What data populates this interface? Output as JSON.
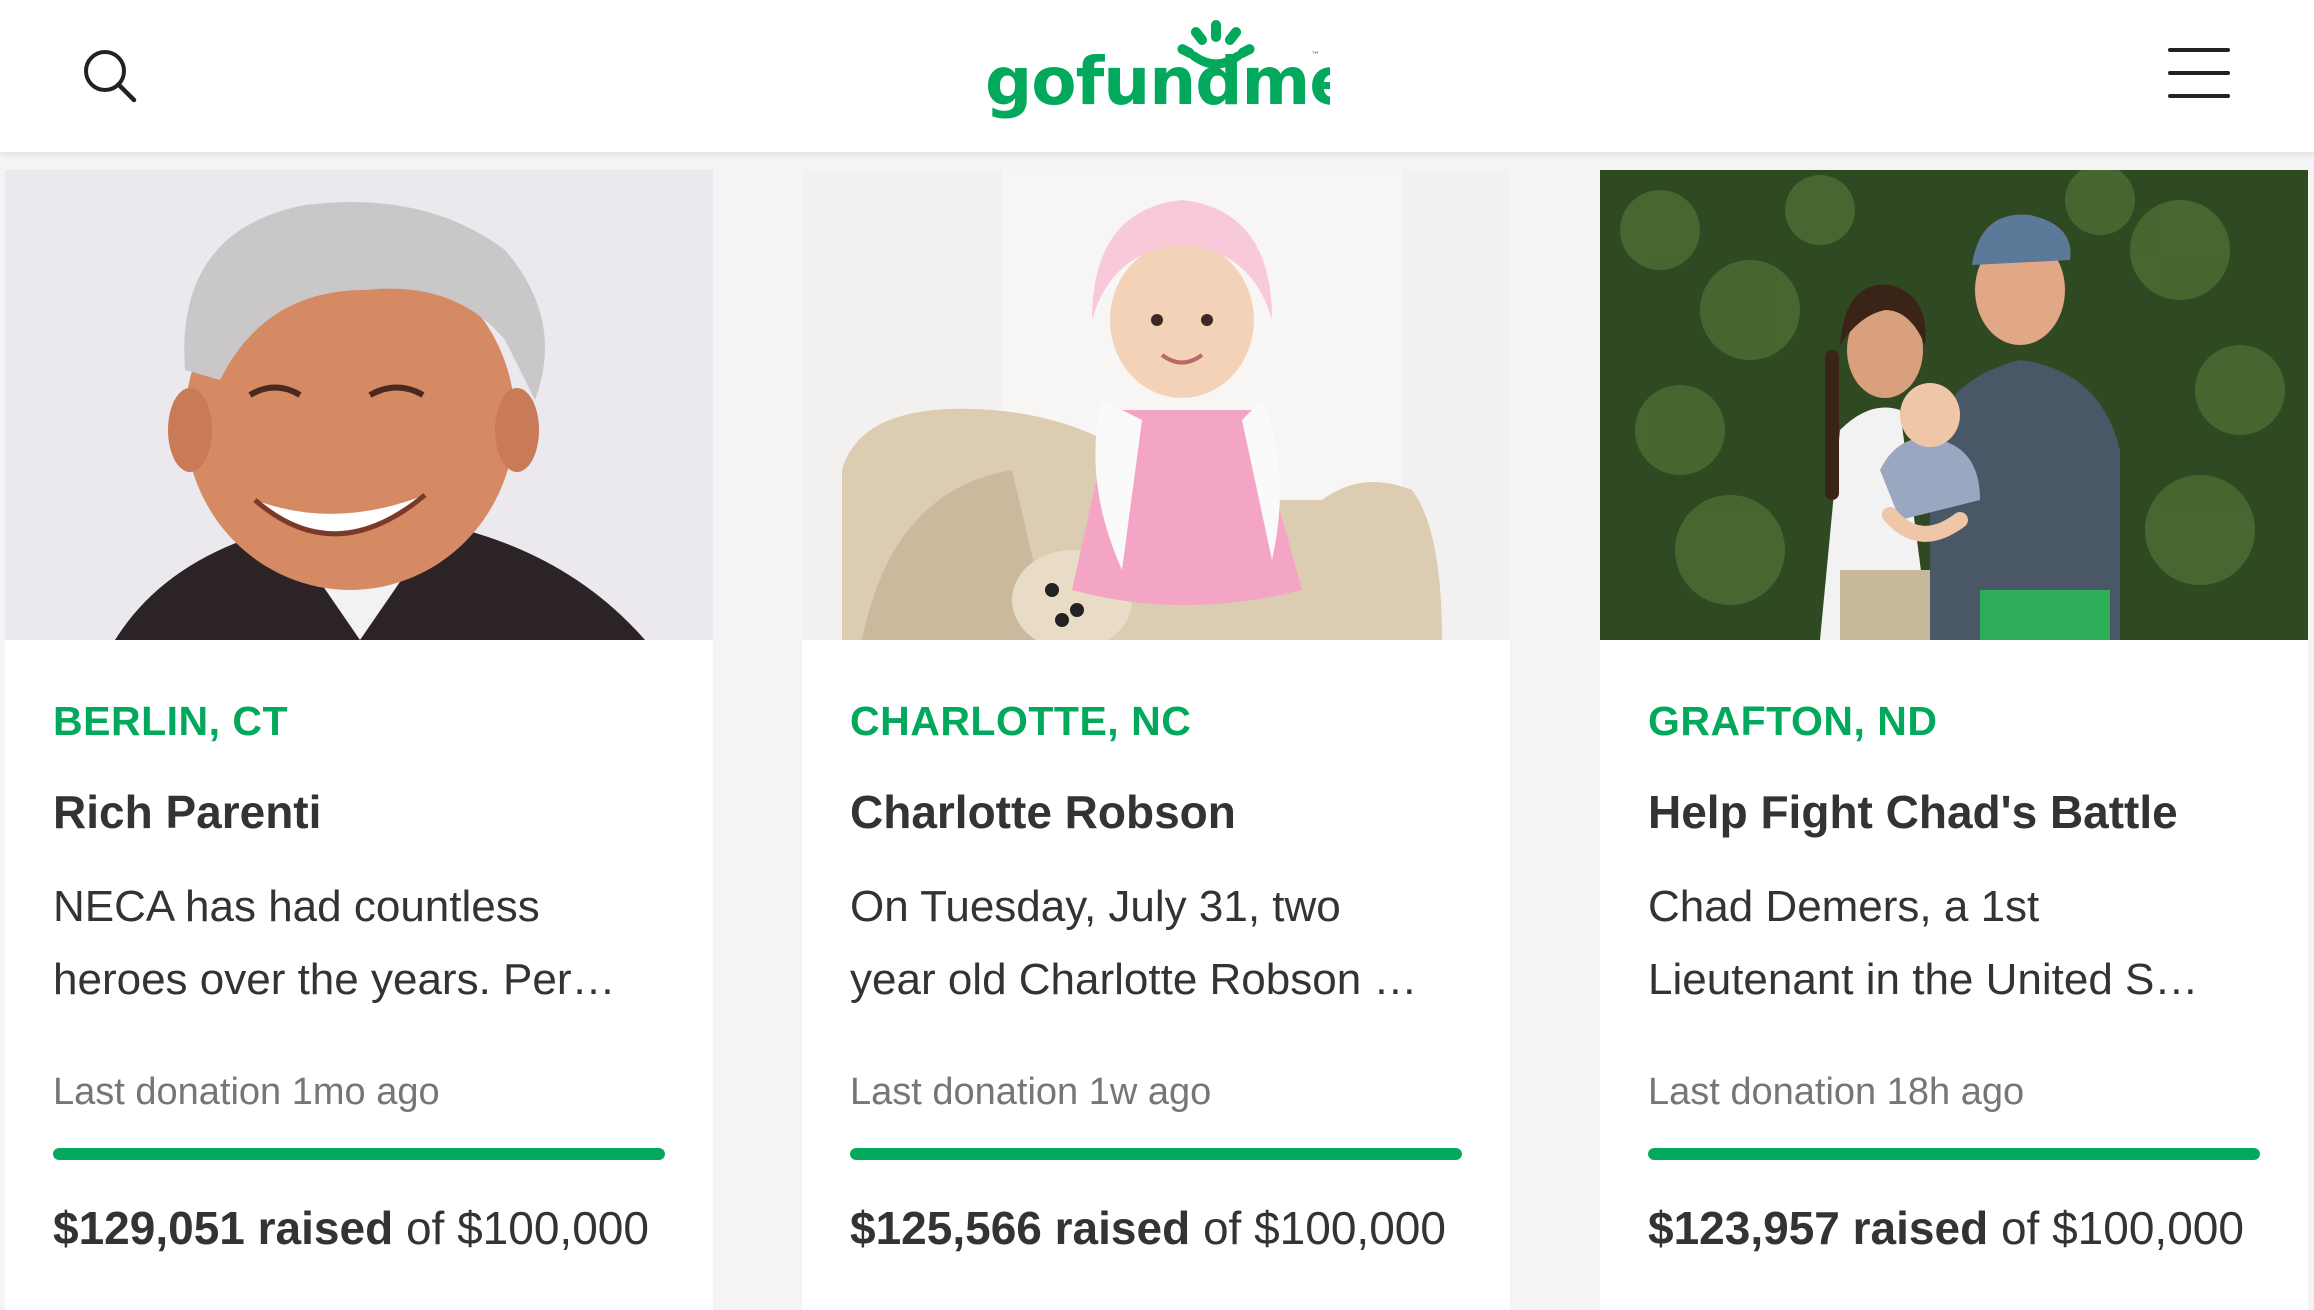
{
  "header": {
    "brand": "gofundme",
    "accent_color": "#02a95c",
    "search_icon": "search-icon",
    "menu_icon": "hamburger-menu-icon"
  },
  "cards": [
    {
      "location": "BERLIN, CT",
      "title": "Rich Parenti",
      "description_line1": "NECA has had countless",
      "description_line2": "heroes over the years.  Per…",
      "last_donation": "Last donation 1mo ago",
      "raised_amount": "$129,051 raised",
      "goal_text": " of $100,000",
      "progress": 1.0
    },
    {
      "location": "CHARLOTTE, NC",
      "title": "Charlotte Robson",
      "description_line1": "On Tuesday, July 31, two",
      "description_line2": "year old Charlotte Robson …",
      "last_donation": "Last donation 1w ago",
      "raised_amount": "$125,566 raised",
      "goal_text": " of $100,000",
      "progress": 1.0
    },
    {
      "location": "GRAFTON, ND",
      "title": "Help Fight Chad's Battle",
      "description_line1": "Chad Demers, a 1st",
      "description_line2": "Lieutenant in the United S…",
      "last_donation": "Last donation 18h ago",
      "raised_amount": "$123,957 raised",
      "goal_text": " of $100,000",
      "progress": 1.0
    }
  ]
}
